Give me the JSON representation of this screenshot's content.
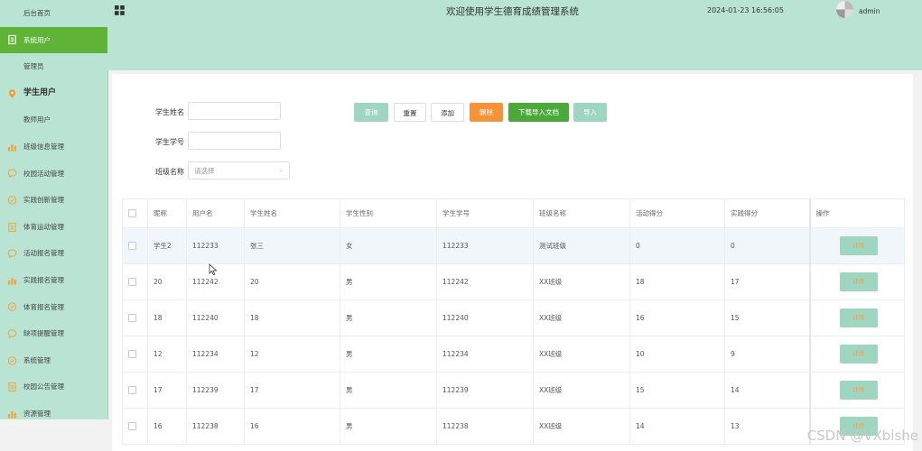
{
  "sidebar": {
    "items": [
      {
        "label": "后台首页",
        "icon": "",
        "type": "sub"
      },
      {
        "label": "系统用户",
        "icon": "document-icon",
        "type": "active"
      },
      {
        "label": "管理员",
        "icon": "",
        "type": "sub"
      },
      {
        "label": "学生用户",
        "icon": "location-pin-icon",
        "type": "group"
      },
      {
        "label": "教师用户",
        "icon": "",
        "type": "sub"
      },
      {
        "label": "班级信息管理",
        "icon": "bar-chart-icon",
        "type": "item"
      },
      {
        "label": "校园活动管理",
        "icon": "chat-bubble-icon",
        "type": "item"
      },
      {
        "label": "实践创新管理",
        "icon": "check-circle-icon",
        "type": "item"
      },
      {
        "label": "体育运动管理",
        "icon": "document-icon",
        "type": "item"
      },
      {
        "label": "活动报名管理",
        "icon": "chat-bubble-icon",
        "type": "item"
      },
      {
        "label": "实践报名管理",
        "icon": "bar-chart-icon",
        "type": "item"
      },
      {
        "label": "体育报名管理",
        "icon": "check-circle-icon",
        "type": "item"
      },
      {
        "label": "缺项提醒管理",
        "icon": "chat-bubble-icon",
        "type": "item"
      },
      {
        "label": "系统管理",
        "icon": "check-circle-icon",
        "type": "item"
      },
      {
        "label": "校园公告管理",
        "icon": "document-icon",
        "type": "item"
      },
      {
        "label": "资源管理",
        "icon": "bar-chart-icon",
        "type": "item"
      }
    ]
  },
  "header": {
    "title": "欢迎使用学生德育成绩管理系统",
    "datetime": "2024-01-23 16:56:05",
    "username": "admin"
  },
  "search": {
    "name_label": "学生姓名",
    "number_label": "学生学号",
    "class_label": "班级名称",
    "class_placeholder": "请选择"
  },
  "toolbar": {
    "query": "查询",
    "reset": "重置",
    "add": "添加",
    "delete": "删除",
    "download": "下载导入文档",
    "import": "导入"
  },
  "table": {
    "headers": [
      "昵称",
      "用户名",
      "学生姓名",
      "学生性别",
      "学生学号",
      "班级名称",
      "活动得分",
      "实践得分",
      "操作"
    ],
    "detail_label": "详情",
    "rows": [
      [
        "学生2",
        "112233",
        "张三",
        "女",
        "112233",
        "测试班级",
        "0",
        "0"
      ],
      [
        "20",
        "112242",
        "20",
        "男",
        "112242",
        "XX班级",
        "18",
        "17"
      ],
      [
        "18",
        "112240",
        "18",
        "男",
        "112240",
        "XX班级",
        "16",
        "15"
      ],
      [
        "12",
        "112234",
        "12",
        "男",
        "112234",
        "XX班级",
        "10",
        "9"
      ],
      [
        "17",
        "112239",
        "17",
        "男",
        "112239",
        "XX班级",
        "15",
        "14"
      ],
      [
        "16",
        "112238",
        "16",
        "男",
        "112238",
        "XX班级",
        "14",
        "13"
      ]
    ]
  },
  "watermark": "CSDN @VXbishe",
  "colors": {
    "theme": "#b9e3d2",
    "active": "#5fb336",
    "delete": "#f69237",
    "download": "#4ba93a",
    "light_button": "#9fd6c1"
  }
}
